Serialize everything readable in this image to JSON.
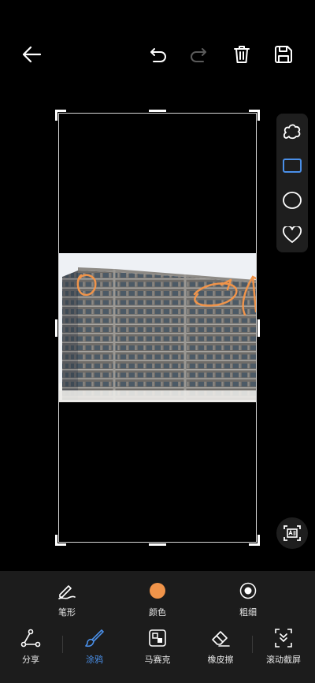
{
  "topbar": {
    "back_icon": "arrow-left-icon",
    "undo_icon": "undo-icon",
    "redo_icon": "redo-icon",
    "delete_icon": "trash-icon",
    "save_icon": "save-icon"
  },
  "shape_panel": [
    "freeform-shape-icon",
    "rectangle-icon",
    "circle-icon",
    "heart-icon"
  ],
  "selected_shape": "rectangle-icon",
  "brush_options": {
    "pen": "笔形",
    "color": "颜色",
    "thickness": "粗细",
    "color_value": "#F0944A"
  },
  "tools": {
    "share": "分享",
    "doodle": "涂鸦",
    "mosaic": "马赛克",
    "eraser": "橡皮擦",
    "scroll": "滚动截屏"
  },
  "colors": {
    "active": "#4A8FE8",
    "annotation": "#F0944A"
  }
}
